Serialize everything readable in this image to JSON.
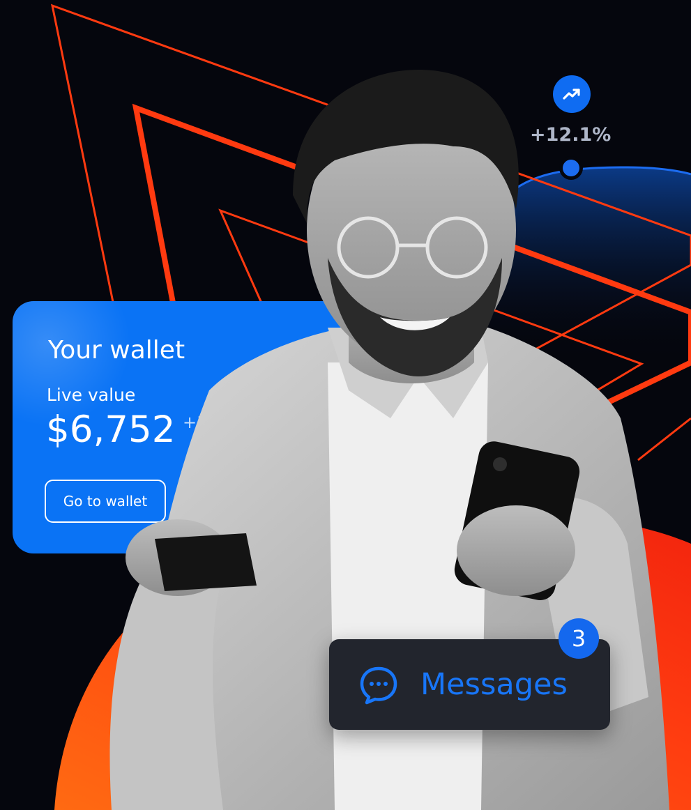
{
  "wallet": {
    "title": "Your wallet",
    "live_value_label": "Live value",
    "value": "$6,752",
    "change": "+12",
    "button_label": "Go to wallet"
  },
  "stat": {
    "icon": "trending-up-icon",
    "value": "+12.1%"
  },
  "messages": {
    "icon": "chat-bubble-icon",
    "label": "Messages",
    "badge_count": "3"
  },
  "colors": {
    "background": "#05060d",
    "accent_blue": "#0a73f5",
    "accent_orange": "#ff4a12",
    "message_card": "#22252d"
  }
}
